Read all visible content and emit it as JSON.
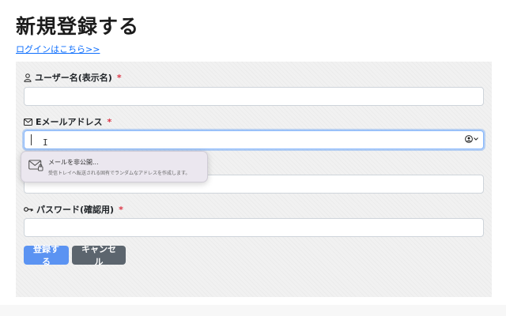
{
  "page": {
    "title": "新規登録する",
    "login_link": "ログインはこちら>>"
  },
  "form": {
    "username": {
      "label": "ユーザー名(表示名)",
      "required_mark": "*",
      "icon": "user-icon",
      "value": ""
    },
    "email": {
      "label": "Eメールアドレス",
      "required_mark": "*",
      "icon": "envelope-icon",
      "value": "",
      "focused": true
    },
    "password": {
      "label": "",
      "value": ""
    },
    "password_confirm": {
      "label": "パスワード(確認用)",
      "required_mark": "*",
      "icon": "key-icon",
      "value": ""
    }
  },
  "autofill_popup": {
    "title": "メールを非公開...",
    "description": "受信トレイへ転送される固有でランダムなアドレスを作成します。",
    "icon": "hide-mail-icon"
  },
  "buttons": {
    "submit": "登録する",
    "cancel": "キャンセル"
  },
  "colors": {
    "primary": "#5b93f2",
    "secondary": "#5c656e",
    "required": "#dc3545",
    "link": "#0d6efd"
  }
}
